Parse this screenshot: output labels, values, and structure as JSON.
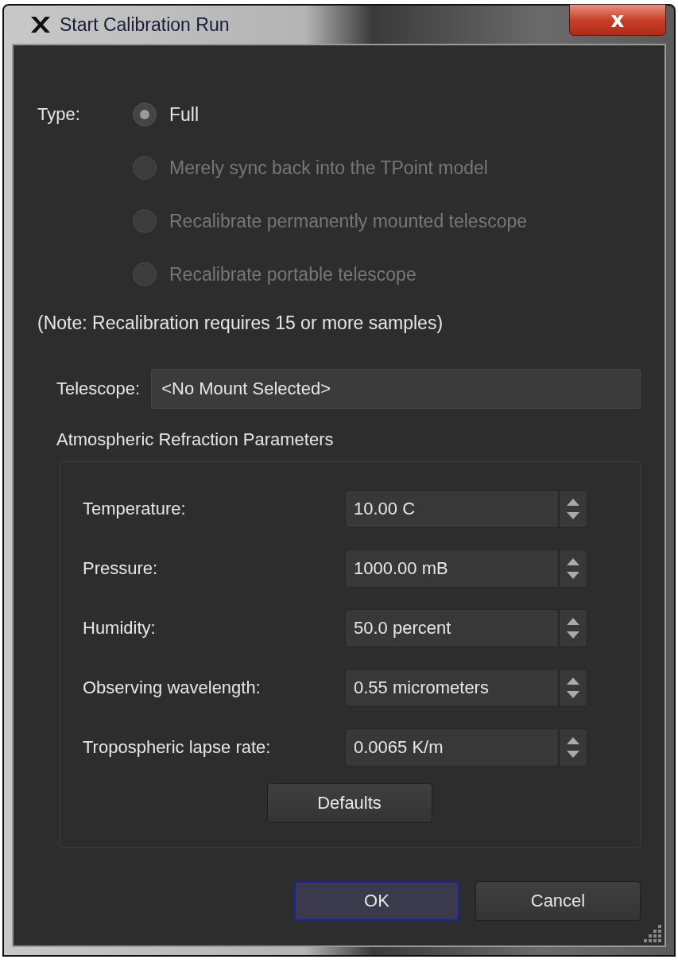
{
  "window": {
    "title": "Start Calibration Run",
    "close": "x"
  },
  "type": {
    "label": "Type:",
    "options": [
      {
        "label": "Full",
        "selected": true,
        "disabled": false
      },
      {
        "label": "Merely sync back into the TPoint model",
        "selected": false,
        "disabled": true
      },
      {
        "label": "Recalibrate permanently mounted telescope",
        "selected": false,
        "disabled": true
      },
      {
        "label": "Recalibrate portable telescope",
        "selected": false,
        "disabled": true
      }
    ]
  },
  "note": "(Note: Recalibration requires 15 or more samples)",
  "telescope": {
    "label": "Telescope:",
    "value": "<No Mount Selected>"
  },
  "refraction": {
    "title": "Atmospheric Refraction Parameters",
    "fields": [
      {
        "label": "Temperature:",
        "value": "10.00 C"
      },
      {
        "label": "Pressure:",
        "value": "1000.00 mB"
      },
      {
        "label": "Humidity:",
        "value": "50.0 percent"
      },
      {
        "label": "Observing wavelength:",
        "value": "0.55 micrometers"
      },
      {
        "label": "Tropospheric lapse rate:",
        "value": "0.0065 K/m"
      }
    ],
    "defaults_button": "Defaults"
  },
  "buttons": [
    {
      "label": "OK",
      "default": true
    },
    {
      "label": "Cancel",
      "default": false
    }
  ]
}
